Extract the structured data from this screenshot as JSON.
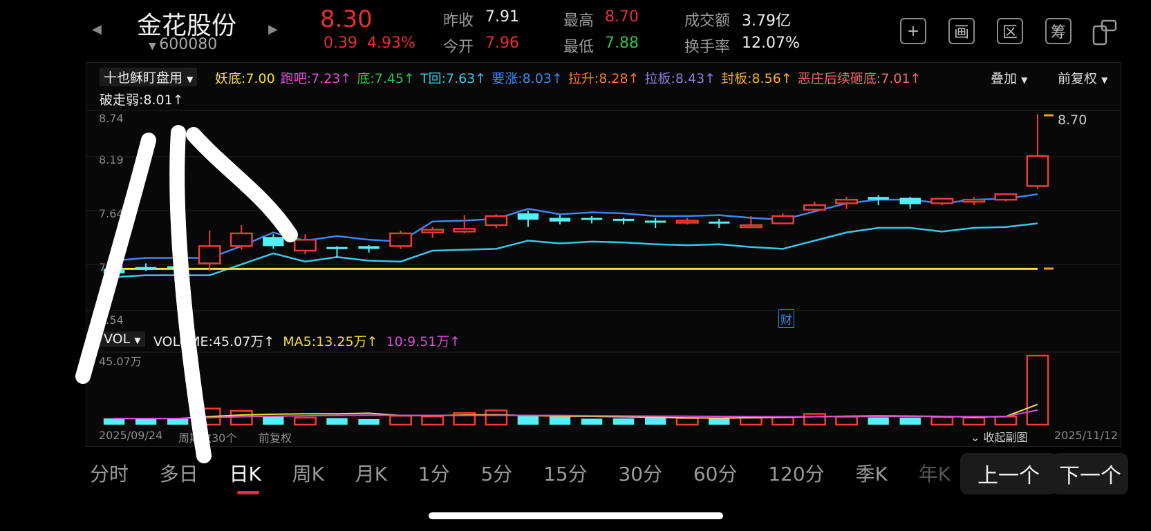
{
  "header": {
    "stock_name": "金花股份",
    "stock_code": "600080",
    "price": "8.30",
    "change": "0.39",
    "change_pct": "4.93%",
    "stats": {
      "prev_close_label": "昨收",
      "prev_close": "7.91",
      "open_label": "今开",
      "open": "7.96",
      "high_label": "最高",
      "high": "8.70",
      "low_label": "最低",
      "low": "7.88",
      "turnover_label": "成交额",
      "turnover": "3.79亿",
      "rate_label": "换手率",
      "rate": "12.07%"
    },
    "tools": [
      "+",
      "画",
      "区",
      "筹"
    ]
  },
  "indicator": {
    "selector": "十也稣盯盘用",
    "items": [
      {
        "label": "妖底:7.00",
        "color": "#f2e03a"
      },
      {
        "label": "跑吧:7.23↑",
        "color": "#d64fd6"
      },
      {
        "label": "底:7.45↑",
        "color": "#2fc24a"
      },
      {
        "label": "T回:7.63↑",
        "color": "#39c8e8"
      },
      {
        "label": "要涨:8.03↑",
        "color": "#3d86f0"
      },
      {
        "label": "拉升:8.28↑",
        "color": "#f07a2a"
      },
      {
        "label": "拉板:8.43↑",
        "color": "#8e78e0"
      },
      {
        "label": "封板:8.56↑",
        "color": "#f2b02a"
      },
      {
        "label": "恶庄后续砸底:7.01↑",
        "color": "#f06a6a"
      }
    ],
    "line2": "破走弱:8.01↑",
    "overlay": "叠加",
    "adjust": "前复权"
  },
  "price_axis": [
    "8.74",
    "8.19",
    "7.64",
    "7.09",
    "6.54"
  ],
  "high_label": "8.70",
  "cai_badge": "财",
  "volume": {
    "selector": "VOL",
    "volume_label": "VOLUME:45.07万↑",
    "ma5_label": "MA5:13.25万↑",
    "ma10_label": "10:9.51万↑",
    "axis_max": "45.07万"
  },
  "footer": {
    "start_date": "2025/09/24",
    "period": "周期数30个",
    "adjust": "前复权",
    "collapse": "收起副图",
    "end_date": "2025/11/12"
  },
  "tabs": [
    "分时",
    "多日",
    "日K",
    "周K",
    "月K",
    "1分",
    "5分",
    "15分",
    "30分",
    "60分",
    "120分",
    "季K",
    "年K"
  ],
  "active_tab": "日K",
  "prev_button": "上一个",
  "next_button": "下一个",
  "chart_data": {
    "type": "candlestick",
    "ylim": [
      6.54,
      8.74
    ],
    "candles": [
      {
        "o": 7.0,
        "c": 6.95,
        "h": 7.03,
        "l": 6.93
      },
      {
        "o": 7.02,
        "c": 7.0,
        "h": 7.06,
        "l": 6.98
      },
      {
        "o": 7.03,
        "c": 7.01,
        "h": 7.05,
        "l": 6.95
      },
      {
        "o": 7.06,
        "c": 7.25,
        "h": 7.42,
        "l": 6.98
      },
      {
        "o": 7.25,
        "c": 7.39,
        "h": 7.48,
        "l": 7.21
      },
      {
        "o": 7.35,
        "c": 7.25,
        "h": 7.38,
        "l": 7.22
      },
      {
        "o": 7.2,
        "c": 7.32,
        "h": 7.38,
        "l": 7.16
      },
      {
        "o": 7.24,
        "c": 7.23,
        "h": 7.25,
        "l": 7.12
      },
      {
        "o": 7.25,
        "c": 7.22,
        "h": 7.26,
        "l": 7.18
      },
      {
        "o": 7.25,
        "c": 7.39,
        "h": 7.42,
        "l": 7.22
      },
      {
        "o": 7.4,
        "c": 7.43,
        "h": 7.46,
        "l": 7.34
      },
      {
        "o": 7.41,
        "c": 7.44,
        "h": 7.59,
        "l": 7.39
      },
      {
        "o": 7.48,
        "c": 7.58,
        "h": 7.6,
        "l": 7.45
      },
      {
        "o": 7.61,
        "c": 7.54,
        "h": 7.64,
        "l": 7.46
      },
      {
        "o": 7.56,
        "c": 7.52,
        "h": 7.59,
        "l": 7.49
      },
      {
        "o": 7.56,
        "c": 7.55,
        "h": 7.58,
        "l": 7.5
      },
      {
        "o": 7.55,
        "c": 7.53,
        "h": 7.56,
        "l": 7.49
      },
      {
        "o": 7.53,
        "c": 7.52,
        "h": 7.56,
        "l": 7.45
      },
      {
        "o": 7.51,
        "c": 7.53,
        "h": 7.56,
        "l": 7.49
      },
      {
        "o": 7.52,
        "c": 7.5,
        "h": 7.55,
        "l": 7.45
      },
      {
        "o": 7.48,
        "c": 7.48,
        "h": 7.58,
        "l": 7.46
      },
      {
        "o": 7.5,
        "c": 7.58,
        "h": 7.61,
        "l": 7.49
      },
      {
        "o": 7.65,
        "c": 7.7,
        "h": 7.74,
        "l": 7.63
      },
      {
        "o": 7.72,
        "c": 7.76,
        "h": 7.79,
        "l": 7.66
      },
      {
        "o": 7.79,
        "c": 7.76,
        "h": 7.81,
        "l": 7.7
      },
      {
        "o": 7.78,
        "c": 7.71,
        "h": 7.79,
        "l": 7.66
      },
      {
        "o": 7.72,
        "c": 7.77,
        "h": 7.78,
        "l": 7.7
      },
      {
        "o": 7.76,
        "c": 7.76,
        "h": 7.79,
        "l": 7.7
      },
      {
        "o": 7.76,
        "c": 7.82,
        "h": 7.83,
        "l": 7.74
      },
      {
        "o": 7.91,
        "c": 8.24,
        "h": 8.7,
        "l": 7.88
      }
    ],
    "lines": [
      {
        "name": "要涨",
        "color": "#3d86f0",
        "values": [
          7.09,
          7.12,
          7.12,
          7.12,
          7.25,
          7.4,
          7.31,
          7.36,
          7.32,
          7.3,
          7.52,
          7.53,
          7.55,
          7.66,
          7.6,
          7.62,
          7.61,
          7.58,
          7.58,
          7.59,
          7.56,
          7.54,
          7.63,
          7.72,
          7.76,
          7.76,
          7.72,
          7.76,
          7.77,
          7.82
        ]
      },
      {
        "name": "T回",
        "color": "#39c8e8",
        "values": [
          6.91,
          6.93,
          6.93,
          6.93,
          7.05,
          7.17,
          7.08,
          7.13,
          7.09,
          7.08,
          7.2,
          7.21,
          7.22,
          7.31,
          7.28,
          7.3,
          7.29,
          7.27,
          7.26,
          7.27,
          7.24,
          7.22,
          7.31,
          7.4,
          7.45,
          7.45,
          7.41,
          7.45,
          7.46,
          7.5
        ]
      },
      {
        "name": "妖底",
        "color": "#f2e03a",
        "values": [
          7.0,
          7.0,
          7.0,
          7.0,
          7.0,
          7.0,
          7.0,
          7.0,
          7.0,
          7.0,
          7.0,
          7.0,
          7.0,
          7.0,
          7.0,
          7.0,
          7.0,
          7.0,
          7.0,
          7.0,
          7.0,
          7.0,
          7.0,
          7.0,
          7.0,
          7.0,
          7.0,
          7.0,
          7.0,
          7.0
        ]
      }
    ],
    "volume_max": 45.07,
    "volumes": [
      4.1,
      3.8,
      3.9,
      10.5,
      9.0,
      5.6,
      4.6,
      4.3,
      3.6,
      5.8,
      5.3,
      7.6,
      9.3,
      6.1,
      5.3,
      3.9,
      4.1,
      5.0,
      4.3,
      4.3,
      4.6,
      4.9,
      7.0,
      5.2,
      4.7,
      4.6,
      4.9,
      4.6,
      5.3,
      45.07
    ],
    "ma5": [
      4.0,
      4.0,
      4.0,
      5.3,
      6.3,
      6.8,
      7.1,
      7.1,
      7.5,
      6.0,
      5.9,
      6.3,
      6.5,
      5.9,
      5.6,
      5.4,
      5.1,
      4.8,
      4.4,
      4.3,
      4.5,
      4.8,
      5.2,
      5.5,
      5.7,
      5.6,
      5.4,
      5.0,
      5.3,
      13.25
    ],
    "ma10": [
      4.0,
      4.0,
      4.0,
      4.6,
      5.2,
      5.5,
      5.8,
      6.0,
      6.2,
      6.1,
      6.0,
      6.0,
      6.1,
      6.1,
      6.0,
      5.8,
      5.7,
      5.6,
      5.5,
      5.4,
      5.3,
      5.2,
      5.2,
      5.3,
      5.3,
      5.3,
      5.3,
      5.3,
      5.3,
      9.51
    ]
  }
}
